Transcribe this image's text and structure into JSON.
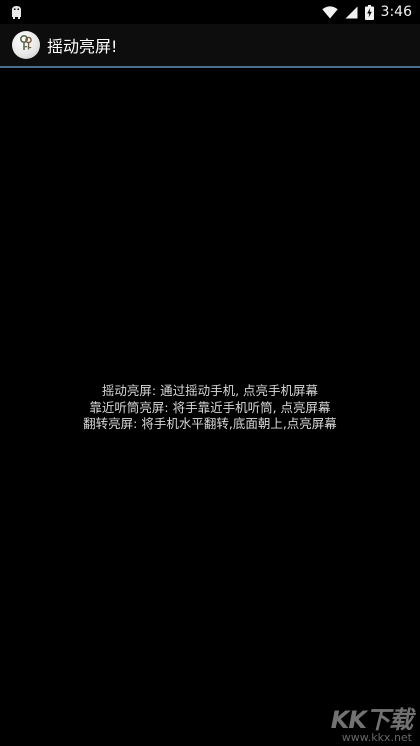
{
  "status_bar": {
    "time": "3:46",
    "battery_glyph": "⚡",
    "icons": [
      "android-debug-icon",
      "wifi-icon",
      "cellular-signal-icon",
      "battery-charging-icon"
    ]
  },
  "action_bar": {
    "title": "摇动亮屏!",
    "divider_color": "#4a6e8c"
  },
  "content": {
    "lines": [
      "摇动亮屏: 通过摇动手机, 点亮手机屏幕",
      "靠近听筒亮屏: 将手靠近手机听筒, 点亮屏幕",
      "翻转亮屏: 将手机水平翻转,底面朝上,点亮屏幕"
    ]
  },
  "watermark": {
    "logo": "KK下载",
    "url": "www.kkx.net"
  }
}
